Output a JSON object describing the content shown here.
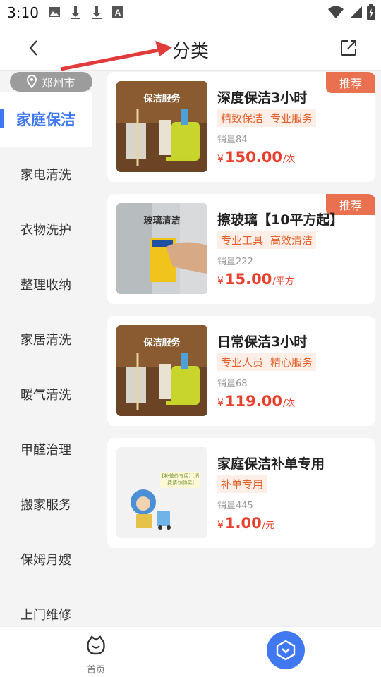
{
  "status_bar": {
    "time": "3:10",
    "icons_left": [
      "image-icon",
      "download-icon",
      "download-icon",
      "font-icon"
    ],
    "icons_right": [
      "wifi-icon",
      "signal-icon",
      "battery-icon"
    ]
  },
  "header": {
    "title": "分类",
    "back_icon": "chevron-left-icon",
    "share_icon": "share-icon"
  },
  "sidebar": {
    "city": "郑州市",
    "items": [
      "家庭保洁",
      "家电清洗",
      "衣物洗护",
      "整理收纳",
      "家居清洗",
      "暖气清洗",
      "甲醛治理",
      "搬家服务",
      "保姆月嫂",
      "上门维修"
    ],
    "active_index": 0
  },
  "products": [
    {
      "title": "深度保洁3小时",
      "tags": [
        "精致保洁",
        "专业服务"
      ],
      "sales": "销量84",
      "currency": "¥",
      "price": "150.00",
      "unit": "/次",
      "badge": "推荐",
      "thumb_label": "保洁服务"
    },
    {
      "title": "擦玻璃【10平方起】",
      "tags": [
        "专业工具",
        "高效清洁"
      ],
      "sales": "销量222",
      "currency": "¥",
      "price": "15.00",
      "unit": "/平方",
      "badge": "推荐",
      "thumb_label": "玻璃清洁"
    },
    {
      "title": "日常保洁3小时",
      "tags": [
        "专业人员",
        "精心服务"
      ],
      "sales": "销量68",
      "currency": "¥",
      "price": "119.00",
      "unit": "/次",
      "badge": "",
      "thumb_label": "保洁服务"
    },
    {
      "title": "家庭保洁补单专用",
      "tags": [
        "补单专用"
      ],
      "sales": "销量445",
      "currency": "¥",
      "price": "1.00",
      "unit": "/元",
      "badge": "",
      "thumb_label": "[补差价专用] [消费请勿购买]"
    }
  ],
  "tabbar": {
    "home_label": "首页"
  },
  "colors": {
    "accent": "#3f78f0",
    "price": "#e8402c",
    "badge": "#e9714f",
    "tag_bg": "#fdefe7",
    "tag_text": "#e3612c"
  }
}
